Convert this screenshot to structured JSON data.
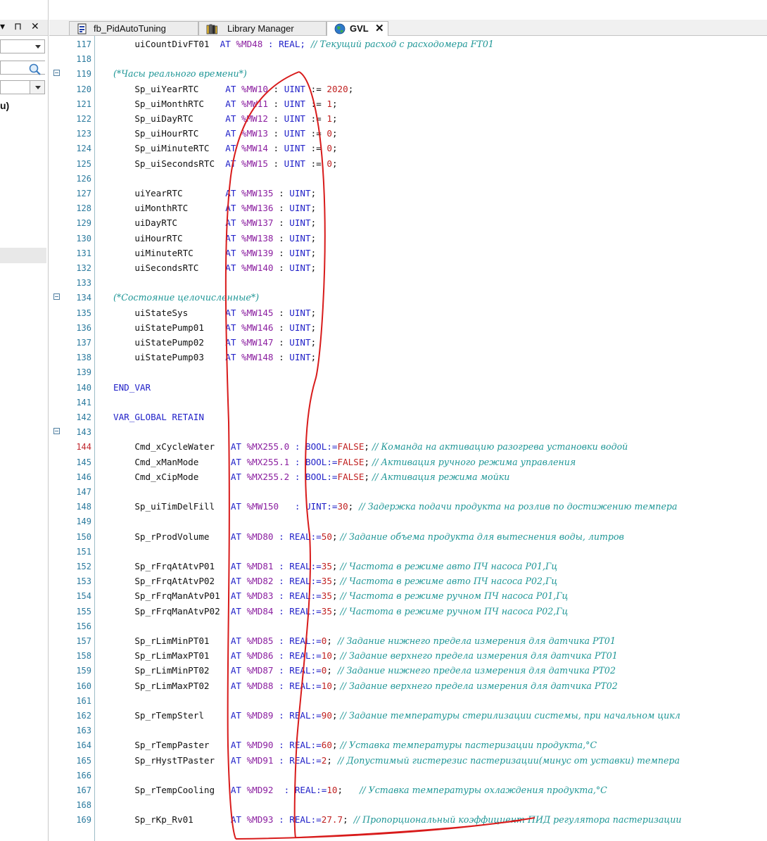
{
  "window": {
    "pin_glyph": "▾ ⊓ ✕"
  },
  "tabs": [
    {
      "label": "fb_PidAutoTuning",
      "icon": "document-grid-icon",
      "active": false
    },
    {
      "label": "Library Manager",
      "icon": "library-books-icon",
      "active": false
    },
    {
      "label": "GVL",
      "icon": "globe-icon",
      "active": true,
      "close": "✕"
    }
  ],
  "left_pane": {
    "fragment_text": "u)"
  },
  "editor": {
    "lines": [
      {
        "n": "117",
        "indent": "    ",
        "name": "uiCountDivFT01",
        "pad": "  ",
        "addr": "%MD48",
        "tail": " : REAL;",
        "comment": "  // Текущий расход с расходомера FT01"
      },
      {
        "n": "118"
      },
      {
        "n": "119",
        "fold": true,
        "header": "(*Часы реального времени*)"
      },
      {
        "n": "120",
        "indent": "    ",
        "name": "Sp_uiYearRTC",
        "pad": "     ",
        "addr": "%MW10",
        "type": "UINT",
        "init": "2020"
      },
      {
        "n": "121",
        "indent": "    ",
        "name": "Sp_uiMonthRTC",
        "pad": "    ",
        "addr": "%MW11",
        "type": "UINT",
        "init": "1"
      },
      {
        "n": "122",
        "indent": "    ",
        "name": "Sp_uiDayRTC",
        "pad": "      ",
        "addr": "%MW12",
        "type": "UINT",
        "init": "1"
      },
      {
        "n": "123",
        "indent": "    ",
        "name": "Sp_uiHourRTC",
        "pad": "     ",
        "addr": "%MW13",
        "type": "UINT",
        "init": "0"
      },
      {
        "n": "124",
        "indent": "    ",
        "name": "Sp_uiMinuteRTC",
        "pad": "   ",
        "addr": "%MW14",
        "type": "UINT",
        "init": "0"
      },
      {
        "n": "125",
        "indent": "    ",
        "name": "Sp_uiSecondsRTC",
        "pad": "  ",
        "addr": "%MW15",
        "type": "UINT",
        "init": "0"
      },
      {
        "n": "126"
      },
      {
        "n": "127",
        "indent": "    ",
        "name": "uiYearRTC",
        "pad": "        ",
        "addr": "%MW135",
        "type": "UINT"
      },
      {
        "n": "128",
        "indent": "    ",
        "name": "uiMonthRTC",
        "pad": "       ",
        "addr": "%MW136",
        "type": "UINT"
      },
      {
        "n": "129",
        "indent": "    ",
        "name": "uiDayRTC",
        "pad": "         ",
        "addr": "%MW137",
        "type": "UINT"
      },
      {
        "n": "130",
        "indent": "    ",
        "name": "uiHourRTC",
        "pad": "        ",
        "addr": "%MW138",
        "type": "UINT"
      },
      {
        "n": "131",
        "indent": "    ",
        "name": "uiMinuteRTC",
        "pad": "      ",
        "addr": "%MW139",
        "type": "UINT"
      },
      {
        "n": "132",
        "indent": "    ",
        "name": "uiSecondsRTC",
        "pad": "     ",
        "addr": "%MW140",
        "type": "UINT"
      },
      {
        "n": "133"
      },
      {
        "n": "134",
        "fold": true,
        "header": "(*Состояние целочисленные*)"
      },
      {
        "n": "135",
        "indent": "    ",
        "name": "uiStateSys",
        "pad": "       ",
        "addr": "%MW145",
        "type": "UINT"
      },
      {
        "n": "136",
        "indent": "    ",
        "name": "uiStatePump01",
        "pad": "    ",
        "addr": "%MW146",
        "type": "UINT"
      },
      {
        "n": "137",
        "indent": "    ",
        "name": "uiStatePump02",
        "pad": "    ",
        "addr": "%MW147",
        "type": "UINT"
      },
      {
        "n": "138",
        "indent": "    ",
        "name": "uiStatePump03",
        "pad": "    ",
        "addr": "%MW148",
        "type": "UINT"
      },
      {
        "n": "139"
      },
      {
        "n": "140",
        "keyword": "END_VAR"
      },
      {
        "n": "141"
      },
      {
        "n": "142",
        "keyword": "VAR_GLOBAL RETAIN"
      },
      {
        "n": "143",
        "fold": true
      },
      {
        "n": "144",
        "red": true,
        "indent": "    ",
        "name": "Cmd_xCycleWater",
        "pad": "   ",
        "addr": "%MX255.0",
        "tail": " : BOOL:=",
        "bool": "FALSE",
        "tail2": ";",
        "comment": " // Команда на активацию разогрева установки водой"
      },
      {
        "n": "145",
        "indent": "    ",
        "name": "Cmd_xManMode",
        "pad": "      ",
        "addr": "%MX255.1",
        "tail": " : BOOL:=",
        "bool": "FALSE",
        "tail2": ";",
        "comment": " // Активация ручного режима управления"
      },
      {
        "n": "146",
        "indent": "    ",
        "name": "Cmd_xCipMode",
        "pad": "      ",
        "addr": "%MX255.2",
        "tail": " : BOOL:=",
        "bool": "FALSE",
        "tail2": ";",
        "comment": " // Активация режима мойки"
      },
      {
        "n": "147"
      },
      {
        "n": "148",
        "indent": "    ",
        "name": "Sp_uiTimDelFill",
        "pad": "   ",
        "addr": "%MW150",
        "tail": "   : UINT:=",
        "val": "30",
        "tail2": ";",
        "comment": "  // Задержка подачи продукта на розлив по достижению темпера"
      },
      {
        "n": "149"
      },
      {
        "n": "150",
        "indent": "    ",
        "name": "Sp_rProdVolume",
        "pad": "    ",
        "addr": "%MD80",
        "tail": " : REAL:=",
        "val": "50",
        "tail2": ";",
        "comment": " // Задание объема продукта для вытеснения воды, литров"
      },
      {
        "n": "151"
      },
      {
        "n": "152",
        "indent": "    ",
        "name": "Sp_rFrqAtAtvP01",
        "pad": "   ",
        "addr": "%MD81",
        "tail": " : REAL:=",
        "val": "35",
        "tail2": ";",
        "comment": " // Частота в режиме авто ПЧ насоса P01,Гц"
      },
      {
        "n": "153",
        "indent": "    ",
        "name": "Sp_rFrqAtAtvP02",
        "pad": "   ",
        "addr": "%MD82",
        "tail": " : REAL:=",
        "val": "35",
        "tail2": ";",
        "comment": " // Частота в режиме авто ПЧ насоса P02,Гц"
      },
      {
        "n": "154",
        "indent": "    ",
        "name": "Sp_rFrqManAtvP01",
        "pad": "  ",
        "addr": "%MD83",
        "tail": " : REAL:=",
        "val": "35",
        "tail2": ";",
        "comment": " // Частота в режиме ручном ПЧ насоса P01,Гц"
      },
      {
        "n": "155",
        "indent": "    ",
        "name": "Sp_rFrqManAtvP02",
        "pad": "  ",
        "addr": "%MD84",
        "tail": " : REAL:=",
        "val": "35",
        "tail2": ";",
        "comment": " // Частота в режиме ручном ПЧ насоса P02,Гц"
      },
      {
        "n": "156"
      },
      {
        "n": "157",
        "indent": "    ",
        "name": "Sp_rLimMinPT01",
        "pad": "    ",
        "addr": "%MD85",
        "tail": " : REAL:=",
        "val": "0",
        "tail2": ";",
        "comment": "  // Задание нижнего предела измерения для датчика PT01"
      },
      {
        "n": "158",
        "indent": "    ",
        "name": "Sp_rLimMaxPT01",
        "pad": "    ",
        "addr": "%MD86",
        "tail": " : REAL:=",
        "val": "10",
        "tail2": ";",
        "comment": " // Задание верхнего предела измерения для датчика PT01"
      },
      {
        "n": "159",
        "indent": "    ",
        "name": "Sp_rLimMinPT02",
        "pad": "    ",
        "addr": "%MD87",
        "tail": " : REAL:=",
        "val": "0",
        "tail2": ";",
        "comment": "  // Задание нижнего предела измерения для датчика PT02"
      },
      {
        "n": "160",
        "indent": "    ",
        "name": "Sp_rLimMaxPT02",
        "pad": "    ",
        "addr": "%MD88",
        "tail": " : REAL:=",
        "val": "10",
        "tail2": ";",
        "comment": " // Задание верхнего предела измерения для датчика PT02"
      },
      {
        "n": "161"
      },
      {
        "n": "162",
        "indent": "    ",
        "name": "Sp_rTempSterl",
        "pad": "     ",
        "addr": "%MD89",
        "tail": " : REAL:=",
        "val": "90",
        "tail2": ";",
        "comment": " // Задание температуры стерилизации системы, при начальном цикл"
      },
      {
        "n": "163"
      },
      {
        "n": "164",
        "indent": "    ",
        "name": "Sp_rTempPaster",
        "pad": "    ",
        "addr": "%MD90",
        "tail": " : REAL:=",
        "val": "60",
        "tail2": ";",
        "comment": " // Уставка температуры пастеризации продукта,°C"
      },
      {
        "n": "165",
        "indent": "    ",
        "name": "Sp_rHystTPaster",
        "pad": "   ",
        "addr": "%MD91",
        "tail": " : REAL:=",
        "val": "2",
        "tail2": ";",
        "comment": "  // Допустимый гистерезис пастеризации(минус от уставки) темпера"
      },
      {
        "n": "166"
      },
      {
        "n": "167",
        "indent": "    ",
        "name": "Sp_rTempCooling",
        "pad": "   ",
        "addr": "%MD92",
        "tail": "  : REAL:=",
        "val": "10",
        "tail2": ";",
        "comment": "      // Уставка температуры охлаждения продукта,°C"
      },
      {
        "n": "168"
      },
      {
        "n": "169",
        "indent": "    ",
        "name": "Sp_rKp_Rv01",
        "pad": "       ",
        "addr": "%MD93",
        "tail": " : REAL:=",
        "val": "27.7",
        "tail2": ";",
        "comment": "  // Пропорциональный коэффициент ПИД регулятора пастеризации"
      }
    ]
  },
  "colors": {
    "keyword": "#1f1fc8",
    "address": "#8b1fa0",
    "number": "#c02020",
    "comment": "#1e9696",
    "line_number": "#2b7a9e",
    "annotation_ink": "#d81b1b"
  }
}
